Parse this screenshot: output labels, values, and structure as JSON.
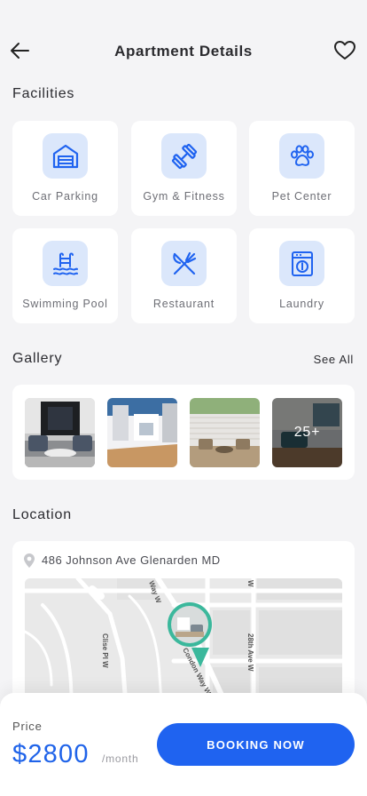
{
  "header": {
    "title": "Apartment Details",
    "back_icon": "arrow-left-icon",
    "favorite_icon": "heart-outline-icon"
  },
  "facilities": {
    "title": "Facilities",
    "items": [
      {
        "label": "Car Parking",
        "icon": "garage-icon"
      },
      {
        "label": "Gym & Fitness",
        "icon": "dumbbell-icon"
      },
      {
        "label": "Pet Center",
        "icon": "paw-icon"
      },
      {
        "label": "Swimming Pool",
        "icon": "pool-icon"
      },
      {
        "label": "Restaurant",
        "icon": "fork-knife-icon"
      },
      {
        "label": "Laundry",
        "icon": "washing-machine-icon"
      }
    ]
  },
  "gallery": {
    "title": "Gallery",
    "see_all": "See All",
    "more_count": "25+"
  },
  "location": {
    "title": "Location",
    "address": "486 Johnson Ave Glenarden MD",
    "streets": [
      "Way W",
      "Clise Pl W",
      "28th Ave W",
      "Condon Way W"
    ]
  },
  "booking": {
    "price_label": "Price",
    "price": "$2800",
    "unit": "/month",
    "button": "BOOKING NOW"
  },
  "colors": {
    "accent": "#1f63f0",
    "icon_bg": "#dbe7fb",
    "map_pin": "#3bb89c"
  }
}
